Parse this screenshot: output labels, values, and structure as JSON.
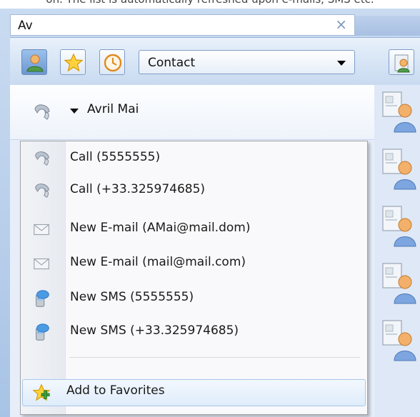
{
  "window": {
    "top_caption": "on. The list is automatically refreshed upon e-mails, SMS etc.",
    "search_value": "Av",
    "close_glyph": "×"
  },
  "toolbar": {
    "buttons": [
      {
        "name": "contacts",
        "icon": "person-icon",
        "pressed": true
      },
      {
        "name": "favorites",
        "icon": "star-icon",
        "pressed": false
      },
      {
        "name": "history",
        "icon": "clock-icon",
        "pressed": false
      }
    ],
    "combo_value": "Contact",
    "right_button_icon": "add-contact-icon"
  },
  "result_row": {
    "name": "Avril  Mai",
    "icon": "phone-handset-icon"
  },
  "context_menu": {
    "items": [
      {
        "label": "Call (5555555)",
        "icon": "phone-handset-icon"
      },
      {
        "label": "Call (+33.325974685)",
        "icon": "phone-handset-icon"
      },
      {
        "label": "New E-mail (AMai@mail.dom)",
        "icon": "envelope-icon"
      },
      {
        "label": "New E-mail (mail@mail.com)",
        "icon": "envelope-icon"
      },
      {
        "label": "New SMS (5555555)",
        "icon": "sms-icon"
      },
      {
        "label": "New SMS (+33.325974685)",
        "icon": "sms-icon"
      }
    ],
    "favorites_label": "Add to Favorites",
    "favorites_icon": "star-plus-icon"
  },
  "colors": {
    "accent_blue": "#6b97d3",
    "frame_blue": "#b7cdea",
    "menu_highlight": "#dfecfb"
  }
}
